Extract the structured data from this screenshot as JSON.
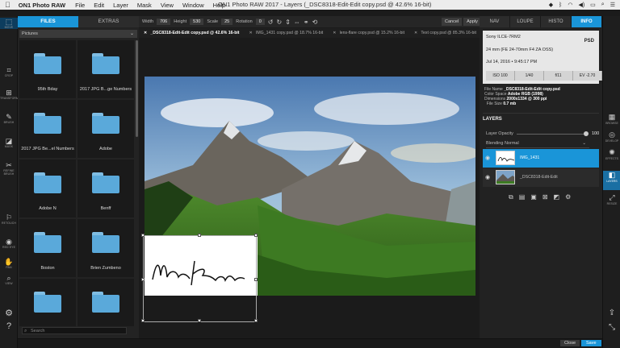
{
  "menubar": {
    "app_name": "ON1 Photo RAW",
    "items": [
      "File",
      "Edit",
      "Layer",
      "Mask",
      "View",
      "Window",
      "Help"
    ],
    "window_title": "ON1 Photo RAW 2017 - Layers (_DSC8318-Edit-Edit copy.psd @ 42.6% 16-bit)"
  },
  "tools": [
    {
      "glyph": "⬚",
      "label": "MOVE"
    },
    {
      "glyph": "⌗",
      "label": "CROP"
    },
    {
      "glyph": "⊞",
      "label": "TRANSFORM"
    },
    {
      "glyph": "✎",
      "label": "BRUSH"
    },
    {
      "glyph": "◪",
      "label": "MASK"
    },
    {
      "glyph": "✂",
      "label": "REFINE BRUSH"
    },
    {
      "glyph": "⚐",
      "label": "RETOUCH"
    },
    {
      "glyph": "◉",
      "label": "RED EYE"
    },
    {
      "glyph": "✋",
      "label": "PAN"
    },
    {
      "glyph": "⌕",
      "label": "VIEW"
    }
  ],
  "bottom_left_icons": [
    "gear-icon",
    "help-icon"
  ],
  "browser": {
    "tabs": [
      "FILES",
      "EXTRAS"
    ],
    "active_tab": "FILES",
    "dropdown_value": "Pictures",
    "folders": [
      "95th Bday",
      "2017 JPG B...ge Numbers",
      "2017 JPG Be...el Numbers",
      "Adobe",
      "Adobe N",
      "Benff",
      "Boston",
      "Brien Zumbeno",
      "",
      ""
    ],
    "search_placeholder": "Search"
  },
  "options": {
    "width_label": "Width",
    "width_value": "706",
    "height_label": "Height",
    "height_value": "530",
    "scale_label": "Scale",
    "scale_value": "25",
    "rotation_label": "Rotation",
    "rotation_value": "0",
    "cancel": "Cancel",
    "apply": "Apply"
  },
  "doc_tabs": [
    "_DSC8318-Edit-Edit copy.psd @ 42.6% 16-bit",
    "IMG_1431 copy.psd @ 18.7% 16-bit",
    "lens-flare copy.psd @ 15.2% 16-bit",
    "Text copy.psd @ 85.3% 16-bit"
  ],
  "right_tabs": [
    "NAV",
    "LOUPE",
    "HISTO",
    "INFO"
  ],
  "active_right_tab": "INFO",
  "info": {
    "camera": "Sony ILCE-7RM2",
    "format": "PSD",
    "lens": "24 mm (FE 24-70mm F4 ZA OSS)",
    "date": "Jul 14, 2016 • 9:45:17 PM",
    "exif": [
      "ISO 100",
      "1/40",
      "f/11",
      "EV -2.70"
    ]
  },
  "meta": {
    "file_name_label": "File Name",
    "file_name": "_DSC8318-Edit-Edit copy.psd",
    "color_space_label": "Color Space",
    "color_space": "Adobe RGB (1998)",
    "dimensions_label": "Dimensions",
    "dimensions": "2000x1334 @ 300 ppi",
    "file_size_label": "File Size",
    "file_size": "0.7 mb"
  },
  "layers": {
    "title": "LAYERS",
    "opacity_label": "Layer Opacity",
    "opacity_value": "100",
    "opacity_fraction": 1.0,
    "blending_label": "Blending",
    "blending_value": "Normal",
    "items": [
      {
        "name": "IMG_1431",
        "selected": true
      },
      {
        "name": "_DSC8318-Edit-Edit",
        "selected": false
      }
    ],
    "actions": [
      "duplicate-layer-icon",
      "new-layer-icon",
      "merge-layer-icon",
      "delete-layer-icon",
      "mask-layer-icon",
      "settings-icon"
    ]
  },
  "modules": [
    {
      "glyph": "▦",
      "label": "BROWSE"
    },
    {
      "glyph": "◎",
      "label": "DEVELOP"
    },
    {
      "glyph": "✺",
      "label": "EFFECTS"
    },
    {
      "glyph": "◧",
      "label": "LAYERS"
    },
    {
      "glyph": "⤢",
      "label": "RESIZE"
    }
  ],
  "active_module": "LAYERS",
  "bottombar": {
    "close": "Close",
    "save": "Save"
  },
  "colors": {
    "accent": "#1a95d8",
    "panel_bg": "#232323",
    "folder": "#5aa9da"
  }
}
